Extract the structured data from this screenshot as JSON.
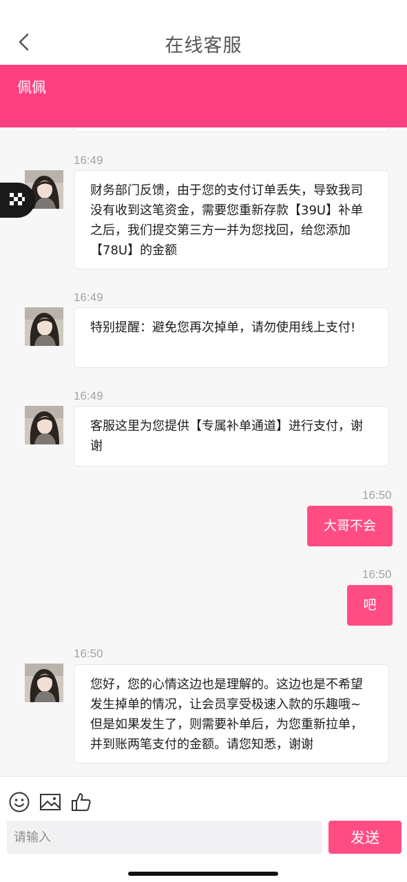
{
  "header": {
    "title": "在线客服",
    "back_icon": "chevron-left-icon"
  },
  "agent": {
    "name": "佩佩",
    "banner_color": "#ff4080"
  },
  "messages": [
    {
      "time": "16:49",
      "text": "财务部门反馈，由于您的支付订单丢失，导致我司没有收到这笔资金，需要您重新存款【39U】补单之后，我们提交第三方一并为您找回，给您添加【78U】的金额"
    },
    {
      "time": "16:49",
      "text": "特别提醒：避免您再次掉单，请勿使用线上支付!"
    },
    {
      "time": "16:49",
      "text": "客服这里为您提供【专属补单通道】进行支付，谢谢"
    },
    {
      "time": "16:50",
      "text": "大哥不会"
    },
    {
      "time": "16:50",
      "text": "吧"
    },
    {
      "time": "16:50",
      "text": "您好，您的心情这边也是理解的。这边也是不希望发生掉单的情况，让会员享受极速入款的乐趣哦~但是如果发生了，则需要补单后，为您重新拉单，并到账两笔支付的金额。请您知悉，谢谢"
    }
  ],
  "composer": {
    "placeholder": "请输入",
    "send_label": "发送",
    "tools": [
      "smiley-icon",
      "image-icon",
      "thumbs-up-icon"
    ],
    "accent_color": "#ff4d84"
  }
}
